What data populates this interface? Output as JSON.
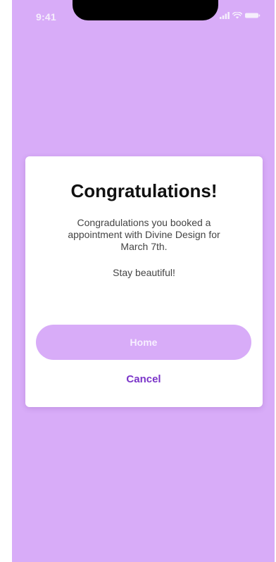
{
  "status_bar": {
    "time": "9:41"
  },
  "dialog": {
    "title": "Congratulations!",
    "message": "Congradulations you booked a\nappointment with Divine Design for\nMarch 7th.",
    "sub_message": "Stay beautiful!",
    "primary_button": "Home",
    "secondary_button": "Cancel"
  },
  "colors": {
    "background": "#d8acf8",
    "card": "#ffffff",
    "primary_button": "#d8acf8",
    "link": "#7a34c8"
  },
  "icons": [
    "signal-icon",
    "wifi-icon",
    "battery-icon"
  ]
}
